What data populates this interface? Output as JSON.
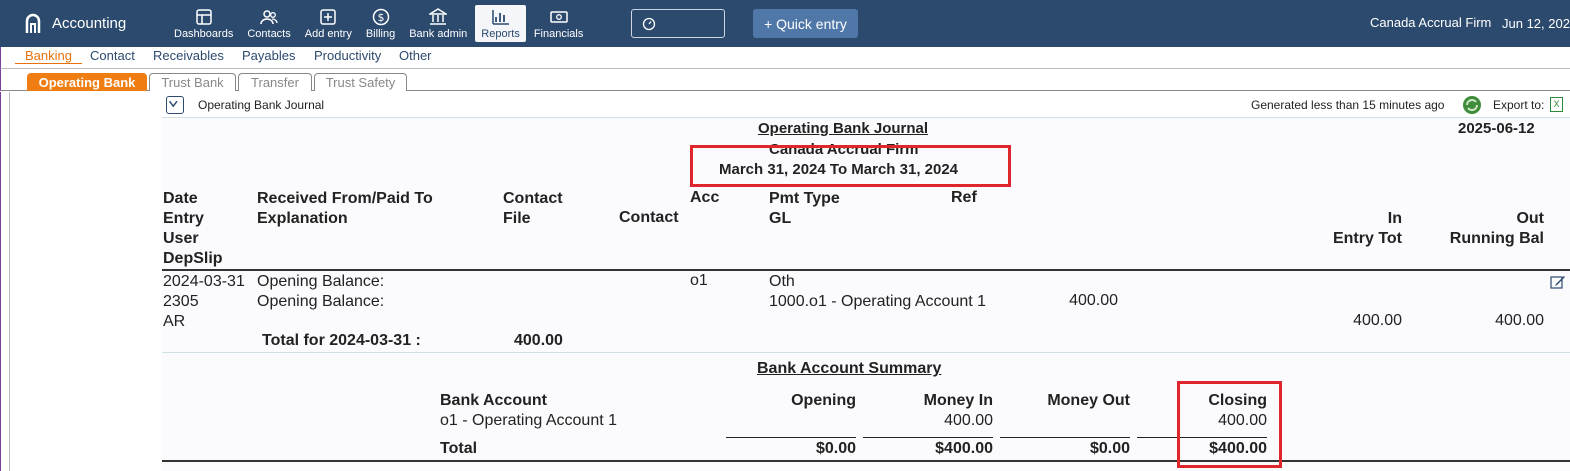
{
  "app": {
    "name": "Accounting"
  },
  "nav": [
    {
      "label": "Dashboards",
      "icon": "dashboard-icon"
    },
    {
      "label": "Contacts",
      "icon": "contacts-icon"
    },
    {
      "label": "Add entry",
      "icon": "add-entry-icon"
    },
    {
      "label": "Billing",
      "icon": "billing-icon"
    },
    {
      "label": "Bank admin",
      "icon": "bank-icon"
    },
    {
      "label": "Reports",
      "icon": "reports-icon",
      "active": true
    },
    {
      "label": "Financials",
      "icon": "financials-icon"
    }
  ],
  "quick_entry": "+ Quick entry",
  "header_right": {
    "firm": "Canada Accrual Firm",
    "date": "Jun 12, 202"
  },
  "subnav": [
    "Banking",
    "Contact",
    "Receivables",
    "Payables",
    "Productivity",
    "Other"
  ],
  "tabs": [
    "Operating Bank",
    "Trust Bank",
    "Transfer",
    "Trust Safety"
  ],
  "report_header": {
    "journal_label": "Operating Bank Journal",
    "generated": "Generated less than 15 minutes ago",
    "export": "Export to:",
    "excel": "X"
  },
  "report": {
    "title": "Operating Bank Journal",
    "report_date": "2025-06-12",
    "firm": "Canada Accrual Firm",
    "range": "March 31, 2024 To March 31, 2024"
  },
  "columns": {
    "c1": [
      "Date",
      "Entry",
      "User",
      "DepSlip"
    ],
    "c2": [
      "Received From/Paid To",
      "Explanation"
    ],
    "c3": [
      "Contact",
      "File"
    ],
    "c4": "Contact",
    "c5": "Acc",
    "c6": [
      "Pmt Type",
      "GL"
    ],
    "c7": "Ref",
    "c8": [
      "In",
      "Entry Tot"
    ],
    "c9": [
      "Out",
      "Running Bal"
    ]
  },
  "entry": {
    "date": "2024-03-31",
    "entry": "2305",
    "user": "AR",
    "received": "Opening Balance:",
    "explanation": "Opening Balance:",
    "acc": "o1",
    "pmt_type": "Oth",
    "gl": "1000.o1 - Operating Account 1",
    "gl_amount": "400.00",
    "entry_tot": "400.00",
    "running_bal": "400.00",
    "total_label": "Total for 2024-03-31 :",
    "total_value": "400.00"
  },
  "summary": {
    "title": "Bank Account Summary",
    "headers": [
      "Bank Account",
      "Opening",
      "Money In",
      "Money Out",
      "Closing"
    ],
    "row": [
      "o1 - Operating Account 1",
      "",
      "400.00",
      "",
      "400.00"
    ],
    "total": [
      "Total",
      "$0.00",
      "$400.00",
      "$0.00",
      "$400.00"
    ]
  }
}
